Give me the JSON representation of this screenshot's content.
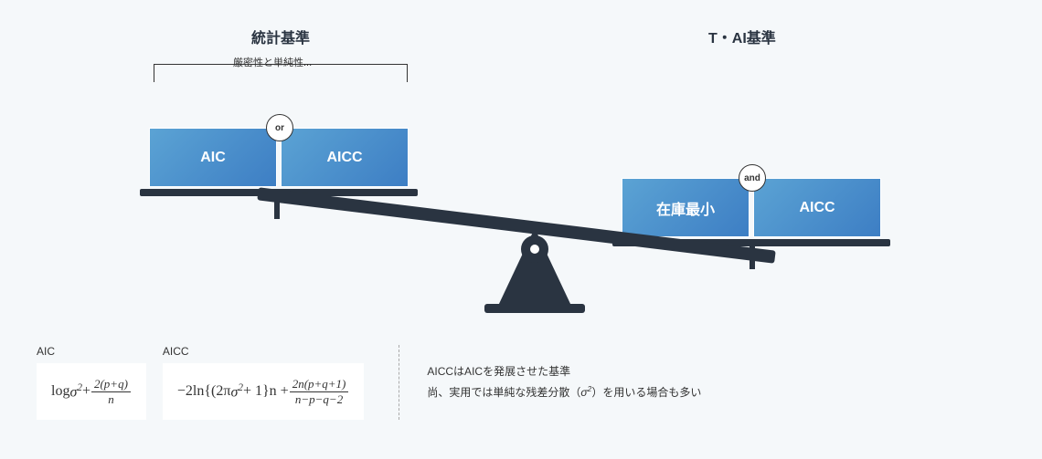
{
  "headers": {
    "left": "統計基準",
    "right": "T・AI基準",
    "left_subtitle": "厳密性と単純性..."
  },
  "left_pan": {
    "box1": "AIC",
    "box2": "AICC",
    "connector": "or"
  },
  "right_pan": {
    "box1": "在庫最小",
    "box2": "AICC",
    "connector": "and"
  },
  "formulas": {
    "aic": {
      "label": "AIC",
      "prefix": "log",
      "term1_base": "σ",
      "term1_exp": "2",
      "plus": " + ",
      "frac_num": "2(p+q)",
      "frac_den": "n"
    },
    "aicc": {
      "label": "AICC",
      "lead": "−2ln{(2π",
      "sigma": "σ",
      "exp2": "2",
      "mid": " + 1}n + ",
      "frac_num": "2n(p+q+1)",
      "frac_den": "n−p−q−2"
    }
  },
  "note": {
    "line1": "AICCはAICを発展させた基準",
    "line2_a": "尚、実用では単純な残差分散（",
    "line2_sigma": "σ",
    "line2_exp": "2",
    "line2_b": "）を用いる場合も多い"
  }
}
